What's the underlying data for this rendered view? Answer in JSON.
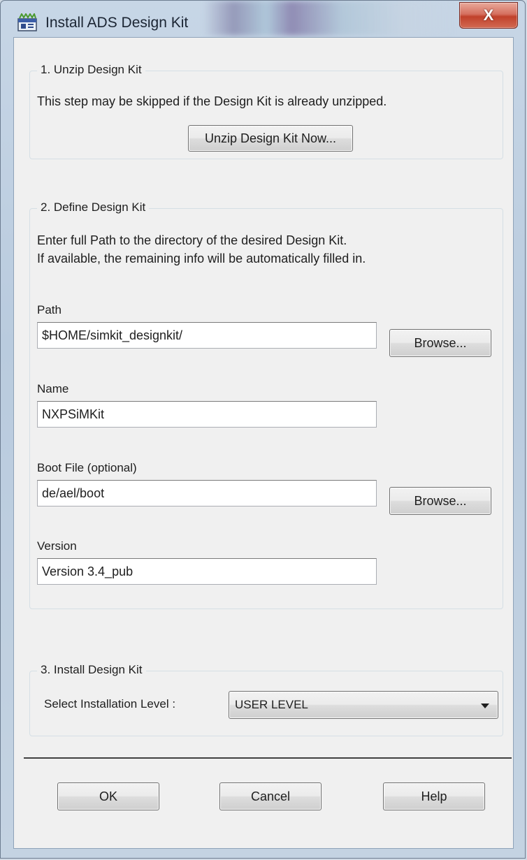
{
  "window": {
    "title": "Install ADS Design Kit",
    "close_glyph": "X",
    "icon": "app-icon"
  },
  "section1": {
    "legend": "1. Unzip Design Kit",
    "description": "This step may be skipped if the Design Kit is already unzipped.",
    "unzip_button": "Unzip Design Kit Now..."
  },
  "section2": {
    "legend": "2. Define Design Kit",
    "description_line1": "Enter full Path to the directory of the desired Design Kit.",
    "description_line2": "If available, the remaining info will be automatically filled in.",
    "path": {
      "label": "Path",
      "value": "$HOME/simkit_designkit/",
      "browse_label": "Browse..."
    },
    "name": {
      "label": "Name",
      "value": "NXPSiMKit"
    },
    "boot_file": {
      "label": "Boot File (optional)",
      "value": "de/ael/boot",
      "browse_label": "Browse..."
    },
    "version": {
      "label": "Version",
      "value": "Version 3.4_pub"
    }
  },
  "section3": {
    "legend": "3. Install Design Kit",
    "level_label": "Select Installation Level :",
    "level_value": "USER LEVEL"
  },
  "footer": {
    "ok_label": "OK",
    "cancel_label": "Cancel",
    "help_label": "Help"
  }
}
